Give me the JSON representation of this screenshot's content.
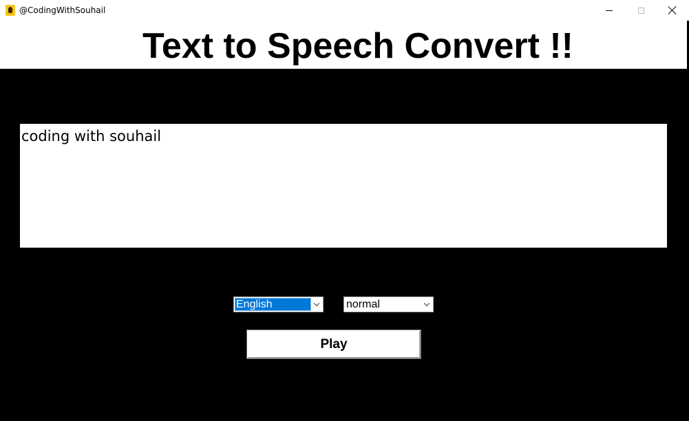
{
  "window": {
    "title": "@CodingWithSouhail",
    "icon": "avatar-icon"
  },
  "header": {
    "title": "Text to Speech Convert !!"
  },
  "main": {
    "text_input": {
      "value": "coding with souhail"
    },
    "language_select": {
      "selected": "English"
    },
    "speed_select": {
      "selected": "normal"
    },
    "play_button": {
      "label": "Play"
    }
  },
  "colors": {
    "background": "#000000",
    "header_background": "#ffffff",
    "selection_highlight": "#0078d7"
  }
}
